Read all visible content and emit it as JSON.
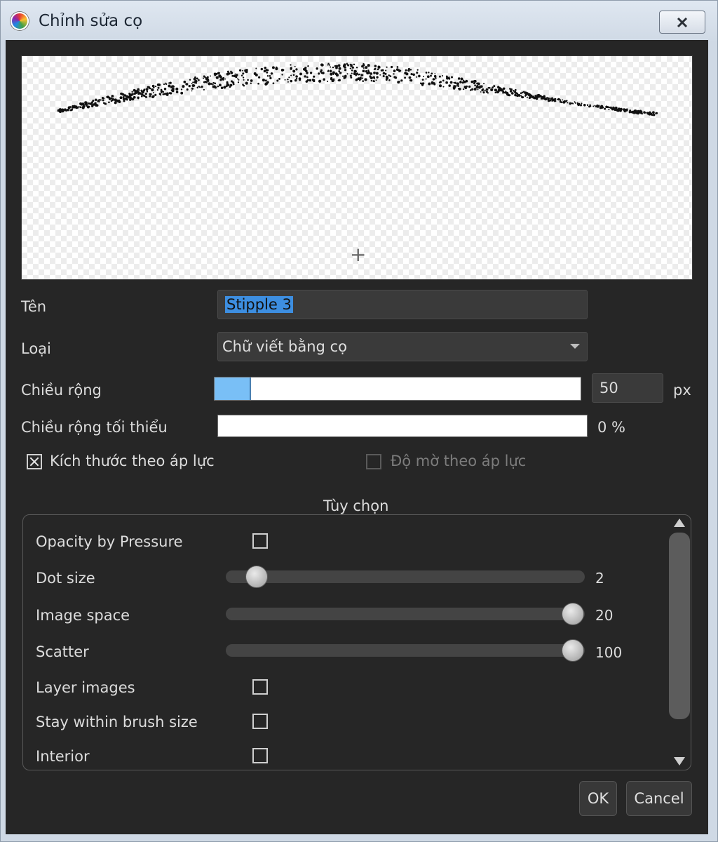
{
  "window": {
    "title": "Chỉnh sửa cọ"
  },
  "preview": {
    "cursor_glyph": "+"
  },
  "form": {
    "name_label": "Tên",
    "name_value": "Stipple 3",
    "type_label": "Loại",
    "type_value": "Chữ viết bằng cọ",
    "width_label": "Chiều rộng",
    "width_value": "50",
    "width_unit": "px",
    "width_fraction": 0.1,
    "min_width_label": "Chiều rộng tối thiểu",
    "min_width_value": "0 %",
    "min_width_fraction": 0.0,
    "size_by_pressure_label": "Kích thước theo áp lực",
    "size_by_pressure_checked": true,
    "opacity_by_pressure_vn_label": "Độ mờ theo áp lực",
    "opacity_by_pressure_vn_checked": false
  },
  "options": {
    "group_title": "Tùy chọn",
    "opacity_by_pressure_label": "Opacity by Pressure",
    "dot_size_label": "Dot size",
    "dot_size_value": "2",
    "image_space_label": "Image space",
    "image_space_value": "20",
    "scatter_label": "Scatter",
    "scatter_value": "100",
    "layer_images_label": "Layer images",
    "stay_within_label": "Stay within brush size",
    "interior_label": "Interior"
  },
  "buttons": {
    "ok": "OK",
    "cancel": "Cancel"
  },
  "colors": {
    "selection": "#3d8ee0",
    "bar_fill": "#79bff6",
    "client_bg": "#262626"
  }
}
